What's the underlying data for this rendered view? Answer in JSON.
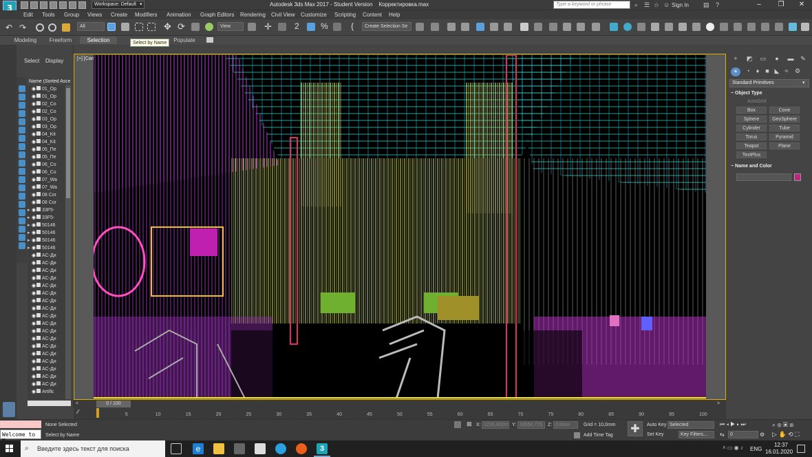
{
  "titlebar": {
    "workspace": "Workspace: Default",
    "title": "Autodesk 3ds Max 2017 - Student Version",
    "file": "Корректировка.max",
    "search_placeholder": "Type a keyword or phrase",
    "sign_in": "Sign In"
  },
  "menus": [
    "Edit",
    "Tools",
    "Group",
    "Views",
    "Create",
    "Modifiers",
    "Animation",
    "Graph Editors",
    "Rendering",
    "Civil View",
    "Customize",
    "Scripting",
    "Content",
    "Help"
  ],
  "toolbar": {
    "filter": "All",
    "view": "View",
    "selection_set": "Create Selection Se"
  },
  "ribbon": {
    "tabs": [
      "Modeling",
      "Freeform",
      "Selection",
      "Object Paint",
      "Populate"
    ],
    "active": "Selection"
  },
  "tooltip": "Select by Name",
  "scene_explorer": {
    "tabs": [
      "Select",
      "Display"
    ],
    "column": "Name (Sorted Ascending)",
    "rows": [
      "01_Op",
      "01_Op",
      "02_Co",
      "02_Co",
      "03_Op",
      "03_Op",
      "04_Kit",
      "04_Kit",
      "05_Пе",
      "05_Пе",
      "06_Co",
      "06_Co",
      "07_Wa",
      "07_Wa",
      "08 Cor",
      "08 Cor",
      "33F5-",
      "33F5-",
      "50146",
      "50146",
      "50146",
      "50146",
      "AC-Ди",
      "AC-Ди",
      "AC-Ди",
      "AC-Ди",
      "AC-Ди",
      "AC-Ди",
      "AC-Ди",
      "AC-Ди",
      "AC-Ди",
      "AC-Ди",
      "AC-Ди",
      "AC-Ди",
      "AC-Ди",
      "AC-Ди",
      "AC-Ди",
      "AC-Ди",
      "AC-Ди",
      "AC-Ди",
      "Artific"
    ]
  },
  "viewport": {
    "label": "[+] [Camera001] [Standard] [Default Shading]"
  },
  "command_panel": {
    "category": "Standard Primitives",
    "object_type_header": "Object Type",
    "autogrid": "AutoGrid",
    "buttons": [
      "Box",
      "Cone",
      "Sphere",
      "GeoSphere",
      "Cylinder",
      "Tube",
      "Torus",
      "Pyramid",
      "Teapot",
      "Plane",
      "TextPlus"
    ],
    "name_color_header": "Name and Color",
    "color": "#c0257e"
  },
  "timeline": {
    "slider": "0 / 100",
    "ticks": [
      "5",
      "10",
      "15",
      "20",
      "25",
      "30",
      "35",
      "40",
      "45",
      "50",
      "55",
      "60",
      "65",
      "70",
      "75",
      "80",
      "85",
      "90",
      "95",
      "100"
    ]
  },
  "status": {
    "script": "Welcome to M",
    "selection": "None Selected",
    "prompt": "Select by Name",
    "x_label": "X:",
    "x": "1220,302m",
    "y_label": "Y:",
    "y": "19550,775",
    "z_label": "Z:",
    "z": "0,0mm",
    "grid": "Grid = 10,0mm",
    "add_time_tag": "Add Time Tag",
    "auto_key": "Auto Key",
    "auto_key_value": "Selected",
    "set_key": "Set Key",
    "key_filters": "Key Filters...",
    "frame": "0"
  },
  "taskbar": {
    "search": "Введите здесь текст для поиска",
    "lang": "ENG",
    "time": "12:37",
    "date": "16.01.2020"
  }
}
